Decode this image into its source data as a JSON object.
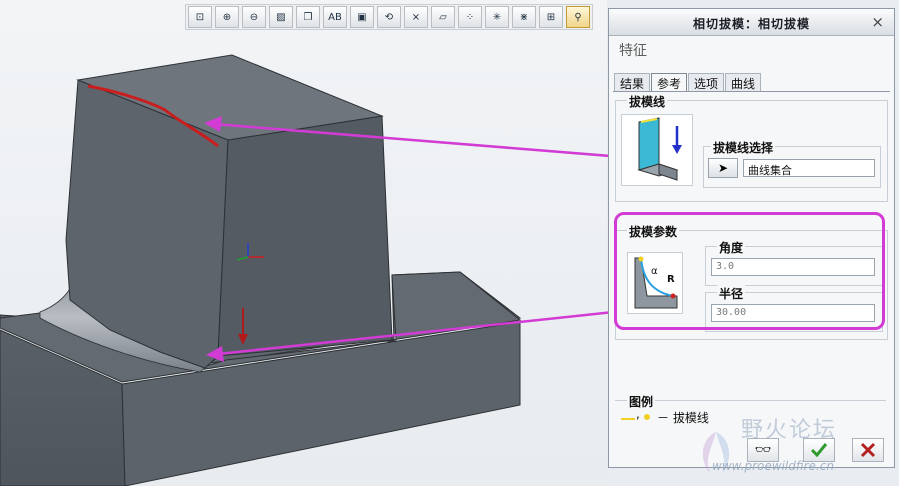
{
  "toolbar": {
    "tools": [
      {
        "name": "zoom-fit-icon",
        "glyph": "⊡"
      },
      {
        "name": "zoom-in-icon",
        "glyph": "⊕"
      },
      {
        "name": "zoom-out-icon",
        "glyph": "⊖"
      },
      {
        "name": "repaint-icon",
        "glyph": "▨"
      },
      {
        "name": "display-style-icon",
        "glyph": "❒"
      },
      {
        "name": "saved-view-icon",
        "glyph": "AB"
      },
      {
        "name": "view-manager-icon",
        "glyph": "▣"
      },
      {
        "name": "spin-center-icon",
        "glyph": "⟲"
      },
      {
        "name": "datum-axes-icon",
        "glyph": "⨯"
      },
      {
        "name": "datum-planes-icon",
        "glyph": "▱"
      },
      {
        "name": "datum-points-icon",
        "glyph": "⁘"
      },
      {
        "name": "datum-csys-icon",
        "glyph": "✳"
      },
      {
        "name": "annotation-icon",
        "glyph": "⋇"
      },
      {
        "name": "display-options-icon",
        "glyph": "⊞"
      },
      {
        "name": "model-tree-icon",
        "glyph": "⚲"
      }
    ]
  },
  "dialog": {
    "title": "相切拔模：相切拔模",
    "close_glyph": "×",
    "feature_label": "特征",
    "tabs": [
      "结果",
      "参考",
      "选项",
      "曲线"
    ],
    "active_tab": 1,
    "draft_line_group": {
      "title": "拔模线",
      "selection_label": "拔模线选择",
      "selection_value": "曲线集合"
    },
    "draft_params_group": {
      "title": "拔模参数",
      "angle_label": "角度",
      "angle_value": "3.0",
      "radius_label": "半径",
      "radius_value": "30.00",
      "diagram_alpha": "α",
      "diagram_r": "R"
    },
    "legend": {
      "title": "图例",
      "separator": ",",
      "description": "－ 拔模线"
    }
  },
  "colors": {
    "annotation": "#d23bd4",
    "model_face": "#5b626b",
    "draft_line": "#c81e1e",
    "ok_green": "#2e9a2e",
    "cancel_red": "#b32020"
  },
  "watermark": {
    "text": "野火论坛",
    "url": "www.proewildfire.cn"
  }
}
